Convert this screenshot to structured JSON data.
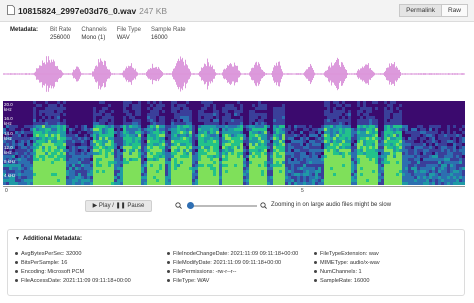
{
  "header": {
    "file_name": "10815824_2997e03d76_0.wav",
    "file_size": "247 KB",
    "buttons": [
      "Permalink",
      "Raw"
    ]
  },
  "metadata": {
    "title": "Metadata:",
    "columns": [
      {
        "label": "Bit Rate",
        "value": "256000"
      },
      {
        "label": "Channels",
        "value": "Mono (1)"
      },
      {
        "label": "File Type",
        "value": "WAV"
      },
      {
        "label": "Sample Rate",
        "value": "16000"
      }
    ]
  },
  "spectrogram": {
    "freq_labels": [
      "20.0 kHz",
      "16.0 kHz",
      "14.0 kHz",
      "12.0 kHz",
      "8 kHz",
      "4 kHz"
    ],
    "time_labels": [
      "0",
      "5"
    ]
  },
  "colors": {
    "waveform": "#d98fd8",
    "spectro_bg": "#3b0a6e",
    "accent": "#2f6fb3"
  },
  "controls": {
    "play_label": "▶ Play / ❚❚ Pause",
    "zoom_note": "Zooming in on large audio files might be slow",
    "zoom_level": 0
  },
  "additional": {
    "title": "Additional Metadata:",
    "col1": [
      "AvgBytesPerSec: 32000",
      "BitsPerSample: 16",
      "Encoding: Microsoft PCM",
      "FileAccessDate: 2021:11:09 09:11:18+00:00"
    ],
    "col2": [
      "FileInodeChangeDate: 2021:11:09 09:11:18+00:00",
      "FileModifyDate: 2021:11:09 09:11:18+00:00",
      "FilePermissions: -rw-r--r--",
      "FileType: WAV"
    ],
    "col3": [
      "FileTypeExtension: wav",
      "MIMEType: audio/x-wav",
      "NumChannels: 1",
      "SampleRate: 16000"
    ]
  }
}
